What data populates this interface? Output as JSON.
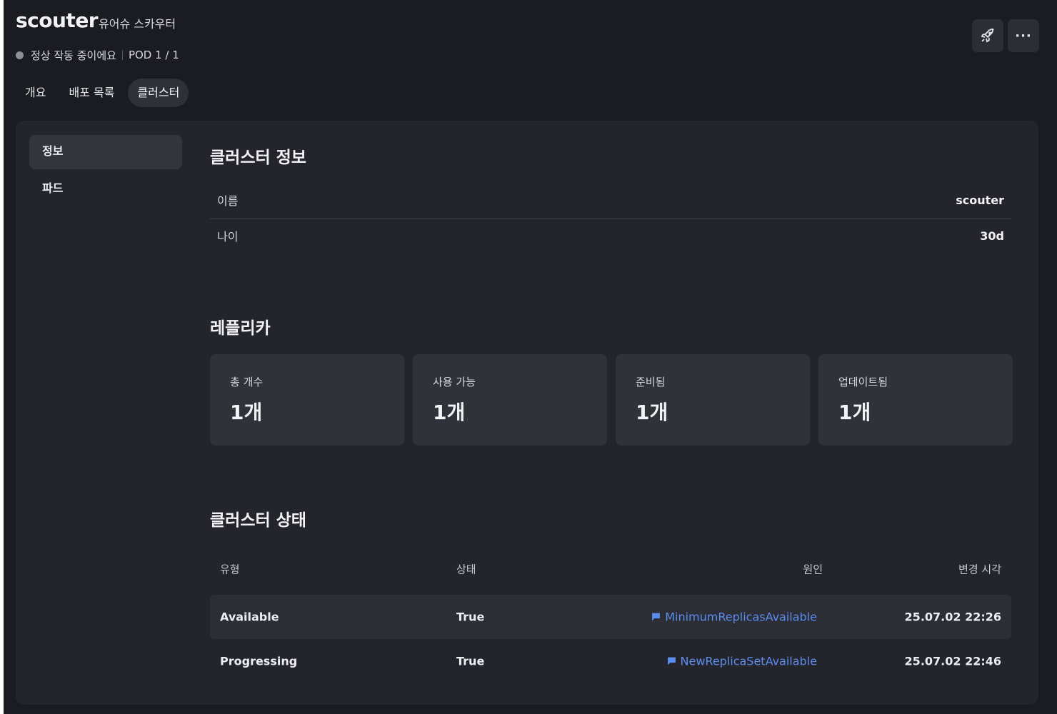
{
  "header": {
    "title": "scouter",
    "subtitle": "유어슈 스카우터",
    "status_text": "정상 작동 중이에요",
    "pod_text": "POD 1 / 1"
  },
  "tabs": [
    {
      "label": "개요",
      "active": false
    },
    {
      "label": "배포 목록",
      "active": false
    },
    {
      "label": "클러스터",
      "active": true
    }
  ],
  "actions": {
    "rocket_icon": "rocket-icon",
    "more_icon": "more-icon",
    "more_glyph": "···"
  },
  "sidebar": {
    "items": [
      {
        "label": "정보",
        "active": true
      },
      {
        "label": "파드",
        "active": false
      }
    ]
  },
  "cluster_info": {
    "title": "클러스터 정보",
    "rows": [
      {
        "key": "이름",
        "value": "scouter"
      },
      {
        "key": "나이",
        "value": "30d"
      }
    ]
  },
  "replicas": {
    "title": "레플리카",
    "cards": [
      {
        "label": "총 개수",
        "value": "1개"
      },
      {
        "label": "사용 가능",
        "value": "1개"
      },
      {
        "label": "준비됨",
        "value": "1개"
      },
      {
        "label": "업데이트됨",
        "value": "1개"
      }
    ]
  },
  "cluster_status": {
    "title": "클러스터 상태",
    "columns": {
      "type": "유형",
      "status": "상태",
      "reason": "원인",
      "time": "변경 시각"
    },
    "rows": [
      {
        "type": "Available",
        "status": "True",
        "reason": "MinimumReplicasAvailable",
        "time": "25.07.02 22:26"
      },
      {
        "type": "Progressing",
        "status": "True",
        "reason": "NewReplicaSetAvailable",
        "time": "25.07.02 22:46"
      }
    ]
  },
  "colors": {
    "background": "#1b1c22",
    "panel": "#24252c",
    "card": "#30323a",
    "link": "#5b8def",
    "status_dot": "#8d9099"
  }
}
